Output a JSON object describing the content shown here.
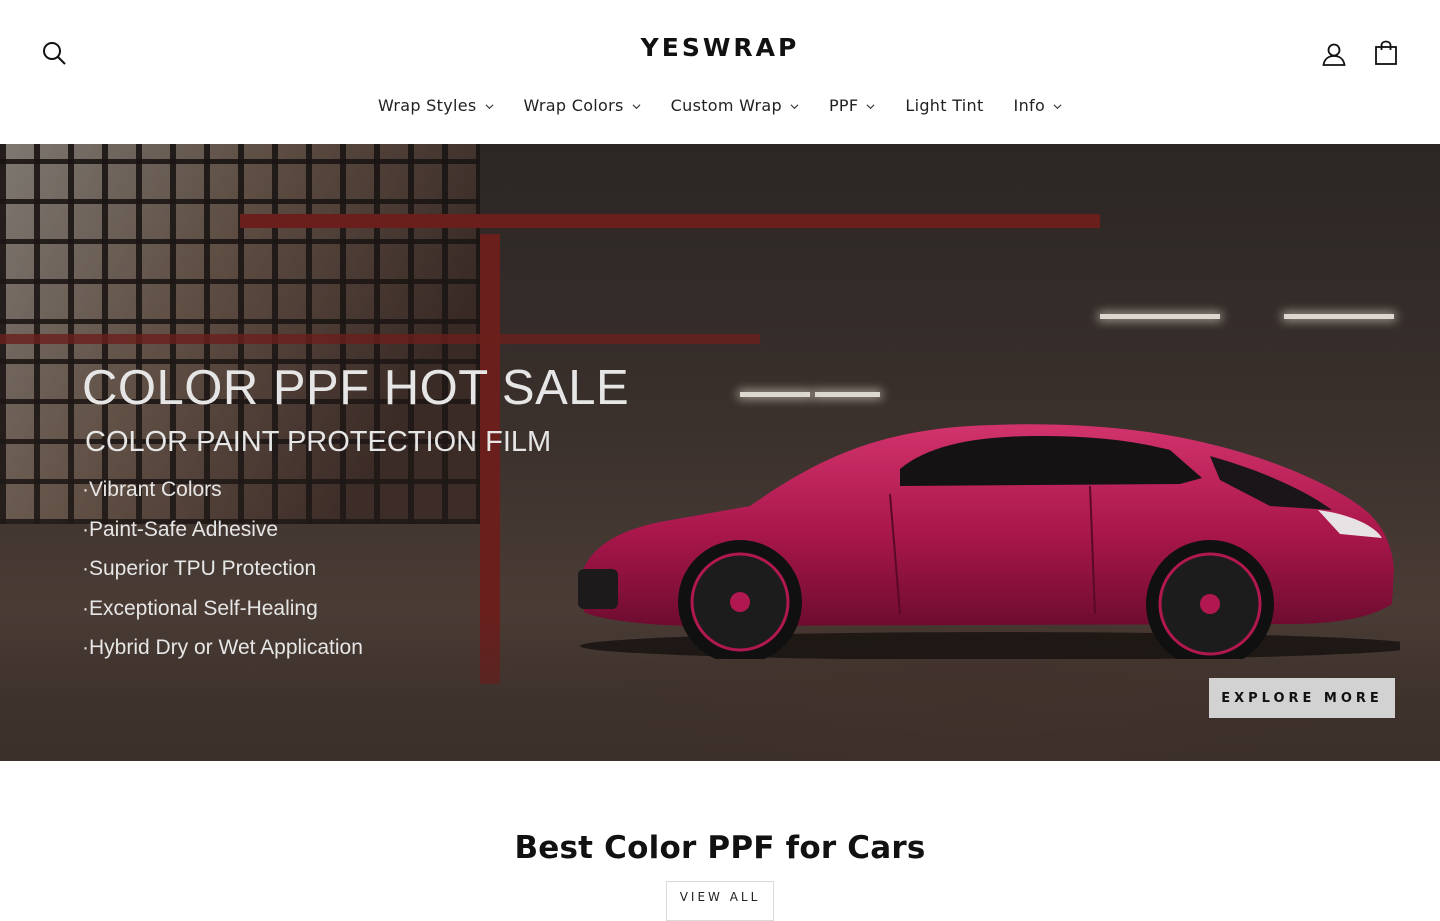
{
  "header": {
    "logo_text": "YESWRAP",
    "icons": {
      "search": "search-icon",
      "account": "user-icon",
      "cart": "shopping-bag-icon"
    },
    "nav": [
      {
        "label": "Wrap Styles",
        "has_dropdown": true
      },
      {
        "label": "Wrap Colors",
        "has_dropdown": true
      },
      {
        "label": "Custom Wrap",
        "has_dropdown": true
      },
      {
        "label": "PPF",
        "has_dropdown": true
      },
      {
        "label": "Light Tint",
        "has_dropdown": false
      },
      {
        "label": "Info",
        "has_dropdown": true
      }
    ]
  },
  "hero": {
    "title": "COLOR PPF HOT SALE",
    "subtitle": "COLOR PAINT PROTECTION FILM",
    "features": [
      "·Vibrant Colors",
      "·Paint-Safe Adhesive",
      "·Superior TPU Protection",
      "·Exceptional Self-Healing",
      "·Hybrid Dry or Wet Application"
    ],
    "cta_label": "EXPLORE MORE",
    "car_color": "#b0184f"
  },
  "section": {
    "title": "Best Color PPF for Cars",
    "view_all_label": "VIEW ALL"
  }
}
